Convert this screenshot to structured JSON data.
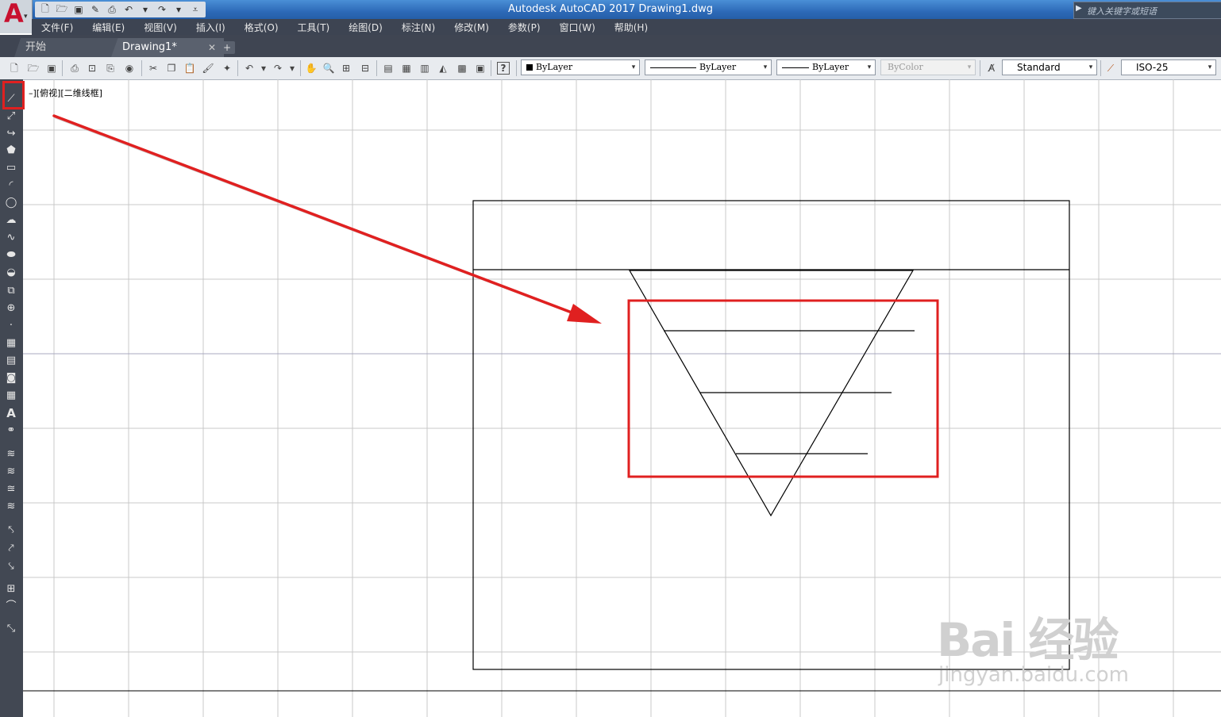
{
  "window": {
    "title": "Autodesk AutoCAD 2017    Drawing1.dwg",
    "search_placeholder": "键入关键字或短语"
  },
  "app_logo": {
    "letter": "A"
  },
  "menu": [
    "文件(F)",
    "编辑(E)",
    "视图(V)",
    "插入(I)",
    "格式(O)",
    "工具(T)",
    "绘图(D)",
    "标注(N)",
    "修改(M)",
    "参数(P)",
    "窗口(W)",
    "帮助(H)"
  ],
  "tabs": {
    "start": "开始",
    "drawing": "Drawing1*",
    "close": "✕",
    "add": "+"
  },
  "toolbar": {
    "color_combo": "ByLayer",
    "linetype_combo": "ByLayer",
    "lineweight_combo": "ByLayer",
    "plotstyle_combo": "ByColor",
    "text_style_combo": "Standard",
    "dim_style_combo": "ISO-25",
    "help_label": "?"
  },
  "viewport": {
    "label": "–][俯视][二维线框]"
  },
  "watermark": {
    "brand": "Bai  经验",
    "url": "jingyan.baidu.com"
  },
  "colors": {
    "highlight_red": "#e02020",
    "grid": "#c8c8c8",
    "grid_major": "#a9a9c2",
    "titlebar": "#2d6ab8"
  },
  "left_toolbar_icons": [
    "line-icon",
    "construction-line-icon",
    "polyline-icon",
    "polygon-icon",
    "rectangle-icon",
    "arc-icon",
    "circle-icon",
    "revision-cloud-icon",
    "spline-icon",
    "ellipse-icon",
    "ellipse-arc-icon",
    "insert-block-icon",
    "make-block-icon",
    "point-icon",
    "hatch-icon",
    "gradient-icon",
    "region-icon",
    "table-icon",
    "multiline-text-icon",
    "add-selected-icon",
    "layer-icon",
    "layer-match-icon",
    "layer-previous-icon",
    "layer-isolate-icon",
    "modify-icon",
    "join-icon",
    "edit-polyline-icon",
    "array-icon",
    "fillet-icon",
    "match-properties-icon"
  ]
}
